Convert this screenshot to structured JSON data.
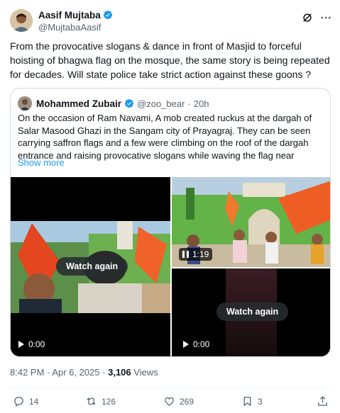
{
  "author": {
    "name": "Aasif Mujtaba",
    "handle": "@MujtabaAasif"
  },
  "tweet": {
    "text": "From the provocative slogans & dance in front of Masjid to forceful hoisting of bhagwa flag on the mosque, the same story is being repeated for decades. Will state police take strict action against these goons ?"
  },
  "quote": {
    "name": "Mohammed Zubair",
    "handle": "@zoo_bear",
    "separator": "·",
    "time": "20h",
    "text": "On the occasion of Ram Navami, A  mob created ruckus at the dargah of Salar Masood Ghazi in the Sangam city of Prayagraj. They can be seen carrying saffron flags and a few were climbing on the roof of the dargah entrance and raising provocative slogans while waving the flag near",
    "show_more": "Show more",
    "videos": [
      {
        "watch_label": "Watch again",
        "duration": "0:00"
      },
      {
        "duration": "1:19"
      },
      {
        "watch_label": "Watch again",
        "duration": "0:00"
      }
    ]
  },
  "meta": {
    "time": "8:42 PM",
    "separator": "·",
    "date": "Apr 6, 2025",
    "views_count": "3,106",
    "views_label": "Views"
  },
  "actions": {
    "replies": "14",
    "reposts": "126",
    "likes": "269",
    "bookmarks": "3"
  },
  "colors": {
    "accent": "#1d9bf0",
    "text": "#0f1419",
    "secondary": "#536471",
    "border": "#cfd9de"
  },
  "icons": [
    "verified-badge-icon",
    "grok-icon",
    "more-icon",
    "play-icon",
    "pause-icon",
    "reply-icon",
    "repost-icon",
    "like-icon",
    "bookmark-icon",
    "share-icon"
  ]
}
